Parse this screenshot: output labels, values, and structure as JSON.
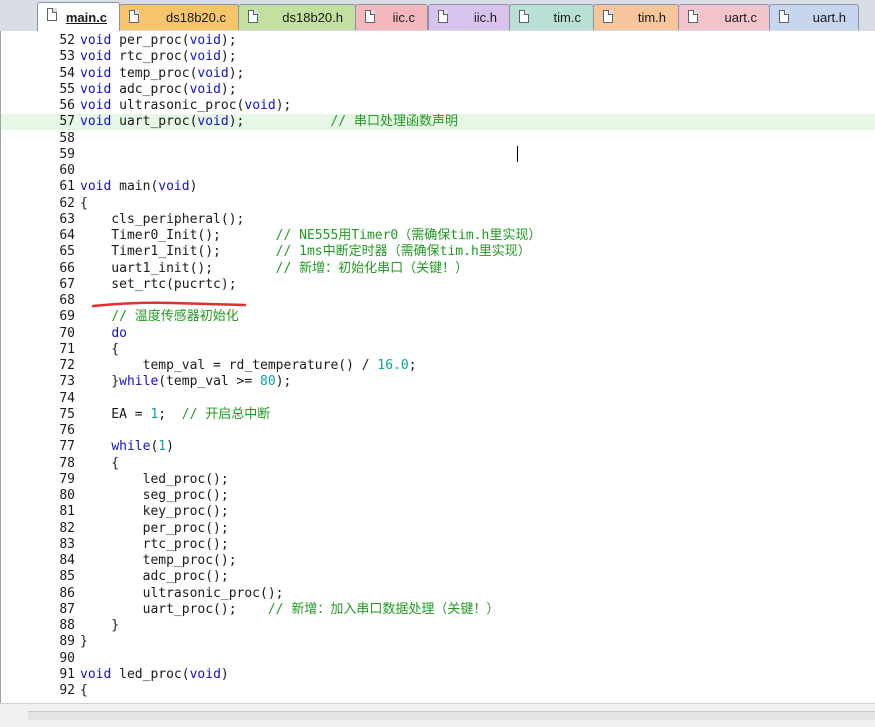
{
  "tabs": [
    {
      "label": "main.c",
      "color": "#ffffff",
      "active": true
    },
    {
      "label": "ds18b20.c",
      "color": "#f6c46a"
    },
    {
      "label": "ds18b20.h",
      "color": "#c2e0a0"
    },
    {
      "label": "iic.c",
      "color": "#f4b8bc"
    },
    {
      "label": "iic.h",
      "color": "#d9c2ee"
    },
    {
      "label": "tim.c",
      "color": "#b8e0d4"
    },
    {
      "label": "tim.h",
      "color": "#f6c69a"
    },
    {
      "label": "uart.c",
      "color": "#f4c4cc"
    },
    {
      "label": "uart.h",
      "color": "#c6d6ee"
    }
  ],
  "lines": [
    {
      "n": "52",
      "code": "<span class=\"kw\">void</span> per_proc(<span class=\"kw\">void</span>);"
    },
    {
      "n": "53",
      "code": "<span class=\"kw\">void</span> rtc_proc(<span class=\"kw\">void</span>);"
    },
    {
      "n": "54",
      "code": "<span class=\"kw\">void</span> temp_proc(<span class=\"kw\">void</span>);"
    },
    {
      "n": "55",
      "code": "<span class=\"kw\">void</span> adc_proc(<span class=\"kw\">void</span>);"
    },
    {
      "n": "56",
      "code": "<span class=\"kw\">void</span> ultrasonic_proc(<span class=\"kw\">void</span>);"
    },
    {
      "n": "57",
      "code": "<span class=\"kw\">void</span> uart_proc(<span class=\"kw\">void</span>);           <span class=\"cm\">// 串口处理函数声明</span>",
      "hl": true
    },
    {
      "n": "58",
      "code": ""
    },
    {
      "n": "59",
      "code": ""
    },
    {
      "n": "60",
      "code": ""
    },
    {
      "n": "61",
      "code": "<span class=\"kw\">void</span> main(<span class=\"kw\">void</span>)"
    },
    {
      "n": "62",
      "code": "{"
    },
    {
      "n": "63",
      "code": "    cls_peripheral();"
    },
    {
      "n": "64",
      "code": "    Timer0_Init();       <span class=\"cm\">// NE555用Timer0（需确保tim.h里实现）</span>"
    },
    {
      "n": "65",
      "code": "    Timer1_Init();       <span class=\"cm\">// 1ms中断定时器（需确保tim.h里实现）</span>"
    },
    {
      "n": "66",
      "code": "    uart1_init();        <span class=\"cm\">// 新增：初始化串口（关键！）</span>"
    },
    {
      "n": "67",
      "code": "    set_rtc(pucrtc);"
    },
    {
      "n": "68",
      "code": ""
    },
    {
      "n": "69",
      "code": "    <span class=\"cm\">// 温度传感器初始化</span>"
    },
    {
      "n": "70",
      "code": "    <span class=\"kw\">do</span>"
    },
    {
      "n": "71",
      "code": "    {"
    },
    {
      "n": "72",
      "code": "        temp_val = rd_temperature() / <span class=\"num\">16.0</span>;"
    },
    {
      "n": "73",
      "code": "    }<span class=\"kw\">while</span>(temp_val >= <span class=\"num\">80</span>);"
    },
    {
      "n": "74",
      "code": ""
    },
    {
      "n": "75",
      "code": "    EA = <span class=\"num\">1</span>;  <span class=\"cm\">// 开启总中断</span>"
    },
    {
      "n": "76",
      "code": ""
    },
    {
      "n": "77",
      "code": "    <span class=\"kw\">while</span>(<span class=\"num\">1</span>)"
    },
    {
      "n": "78",
      "code": "    {"
    },
    {
      "n": "79",
      "code": "        led_proc();"
    },
    {
      "n": "80",
      "code": "        seg_proc();"
    },
    {
      "n": "81",
      "code": "        key_proc();"
    },
    {
      "n": "82",
      "code": "        per_proc();"
    },
    {
      "n": "83",
      "code": "        rtc_proc();"
    },
    {
      "n": "84",
      "code": "        temp_proc();"
    },
    {
      "n": "85",
      "code": "        adc_proc();"
    },
    {
      "n": "86",
      "code": "        ultrasonic_proc();"
    },
    {
      "n": "87",
      "code": "        uart_proc();    <span class=\"cm\">// 新增：加入串口数据处理（关键！）</span>"
    },
    {
      "n": "88",
      "code": "    }"
    },
    {
      "n": "89",
      "code": "}"
    },
    {
      "n": "90",
      "code": ""
    },
    {
      "n": "91",
      "code": "<span class=\"kw\">void</span> led_proc(<span class=\"kw\">void</span>)"
    },
    {
      "n": "92",
      "code": "{"
    }
  ],
  "colors": {
    "keyword": "#1111cc",
    "number": "#0aa2a2",
    "comment": "#229922",
    "highlight": "#e6f7e6",
    "annotation": "#e03030"
  }
}
